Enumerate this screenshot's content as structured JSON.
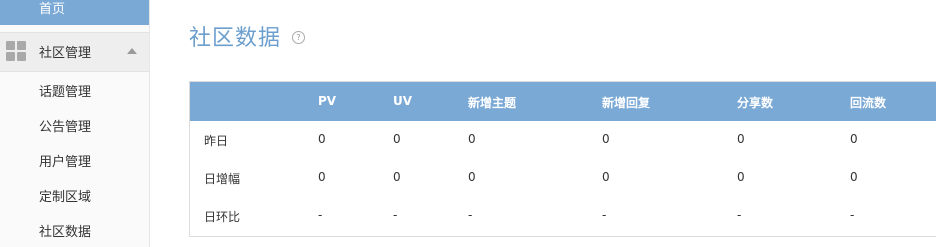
{
  "sidebar": {
    "home": "首页",
    "group_label": "社区管理",
    "items": [
      "话题管理",
      "公告管理",
      "用户管理",
      "定制区域",
      "社区数据"
    ]
  },
  "main": {
    "title": "社区数据",
    "help": "?"
  },
  "table": {
    "headers": [
      "",
      "PV",
      "UV",
      "新增主题",
      "新增回复",
      "分享数",
      "回流数"
    ],
    "rows": [
      [
        "昨日",
        "0",
        "0",
        "0",
        "0",
        "0",
        "0"
      ],
      [
        "日增幅",
        "0",
        "0",
        "0",
        "0",
        "0",
        "0"
      ],
      [
        "日环比",
        "-",
        "-",
        "-",
        "-",
        "-",
        "-"
      ]
    ]
  },
  "colors": {
    "accent": "#7aa9d6",
    "title": "#6c9fce"
  }
}
